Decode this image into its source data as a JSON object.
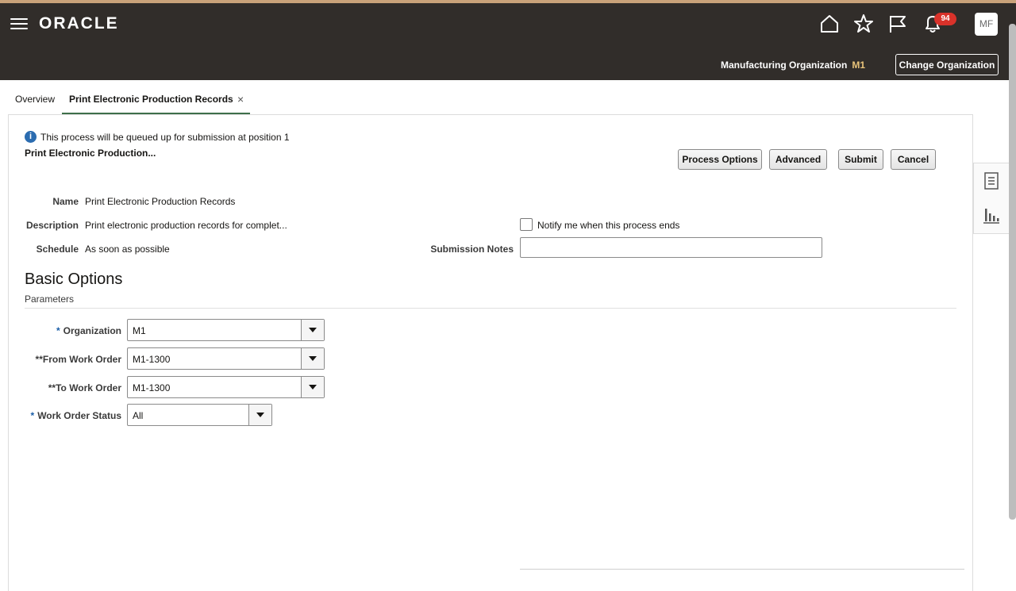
{
  "header": {
    "logo": "ORACLE",
    "notification_count": "94",
    "avatar_initials": "MF",
    "org_label": "Manufacturing Organization",
    "org_code": "M1",
    "change_org_label": "Change Organization"
  },
  "tabs": [
    {
      "label": "Overview"
    },
    {
      "label": "Print Electronic Production Records",
      "close": "×"
    }
  ],
  "process": {
    "info_message": "This process will be queued up for submission at position 1",
    "short_title": "Print Electronic Production...",
    "buttons": {
      "process_options": "Process Options",
      "advanced": "Advanced",
      "submit": "Submit",
      "cancel": "Cancel"
    },
    "fields": {
      "name_label": "Name",
      "name_value": "Print Electronic Production Records",
      "description_label": "Description",
      "description_value": "Print electronic production records for complet...",
      "schedule_label": "Schedule",
      "schedule_value": "As soon as possible",
      "notify_label": "Notify me when this process ends",
      "notes_label": "Submission Notes",
      "notes_value": ""
    }
  },
  "basic_options": {
    "title": "Basic Options",
    "subtitle": "Parameters",
    "params": [
      {
        "label": "Organization",
        "required": "*",
        "value": "M1"
      },
      {
        "label": "**From Work Order",
        "value": "M1-1300"
      },
      {
        "label": "**To Work Order",
        "value": "M1-1300"
      },
      {
        "label": "Work Order Status",
        "required": "*",
        "value": "All"
      }
    ]
  }
}
